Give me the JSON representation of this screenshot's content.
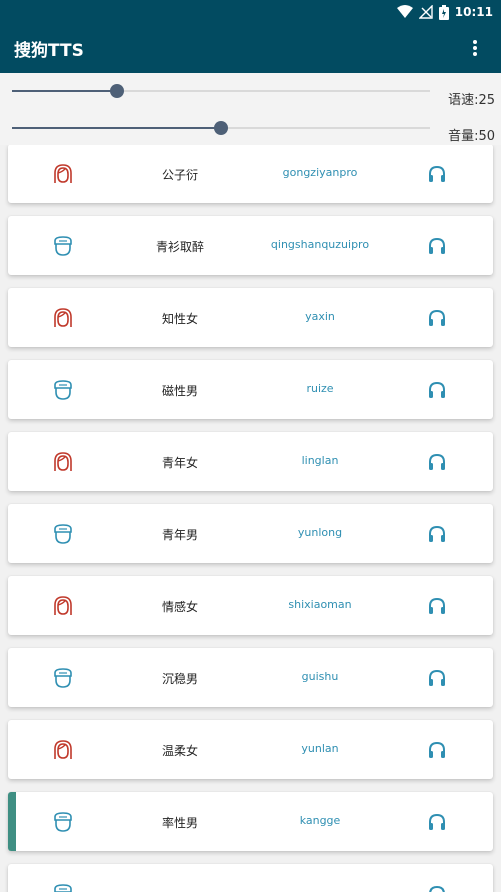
{
  "status": {
    "time": "10:11"
  },
  "appbar": {
    "title": "搜狗TTS",
    "menu_icon": "more-vert-icon"
  },
  "controls": {
    "speed": {
      "label": "语速:25",
      "value": 25,
      "max": 100
    },
    "volume": {
      "label": "音量:50",
      "value": 50,
      "max": 100
    }
  },
  "colors": {
    "primary": "#024b61",
    "female": "#c0392b",
    "male": "#2f8fb2",
    "selected": "#3f8f83"
  },
  "voices": [
    {
      "name": "公子衍",
      "code": "gongziyanpro",
      "gender": "female"
    },
    {
      "name": "青衫取醉",
      "code": "qingshanquzuipro",
      "gender": "male"
    },
    {
      "name": "知性女",
      "code": "yaxin",
      "gender": "female"
    },
    {
      "name": "磁性男",
      "code": "ruize",
      "gender": "male"
    },
    {
      "name": "青年女",
      "code": "linglan",
      "gender": "female"
    },
    {
      "name": "青年男",
      "code": "yunlong",
      "gender": "male"
    },
    {
      "name": "情感女",
      "code": "shixiaoman",
      "gender": "female"
    },
    {
      "name": "沉稳男",
      "code": "guishu",
      "gender": "male"
    },
    {
      "name": "温柔女",
      "code": "yunlan",
      "gender": "female"
    },
    {
      "name": "率性男",
      "code": "kangge",
      "gender": "male",
      "selected": true
    },
    {
      "name": "",
      "code": "",
      "gender": "male"
    }
  ]
}
